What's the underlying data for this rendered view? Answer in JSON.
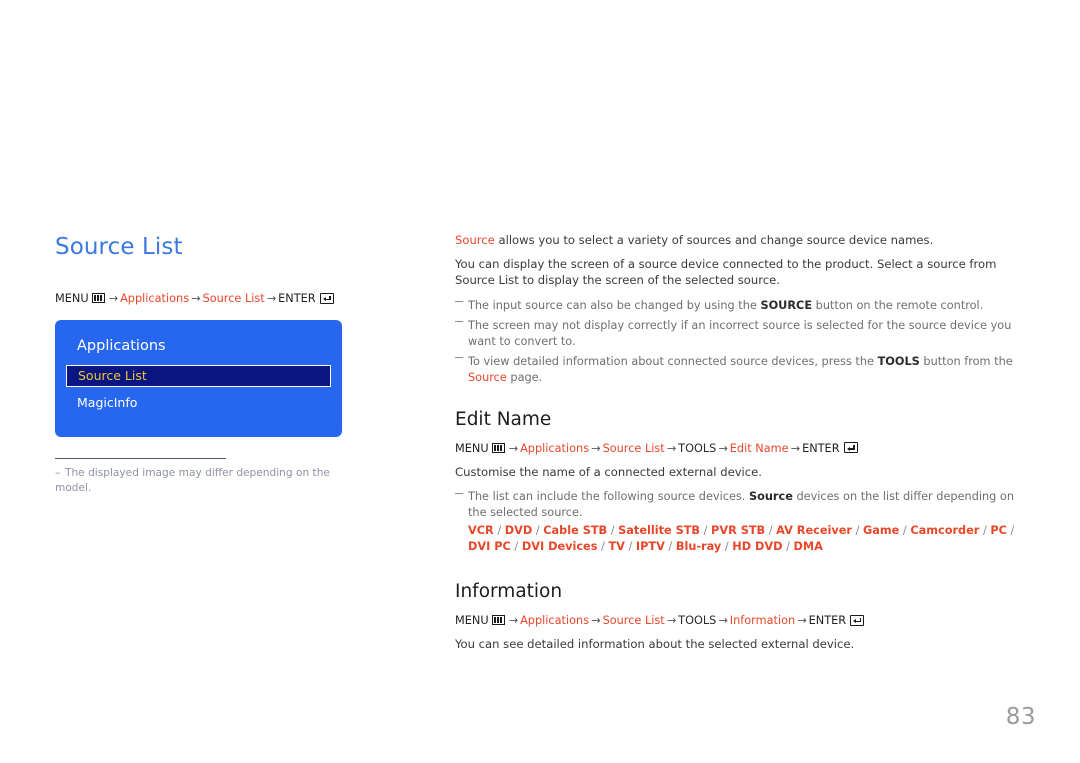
{
  "page": {
    "number": "83"
  },
  "left": {
    "title": "Source List",
    "menu_path": {
      "menu_label": "MENU",
      "menu_icon": "menu-grid-icon",
      "steps": [
        "Applications",
        "Source List"
      ],
      "enter_label": "ENTER",
      "enter_icon": "enter-return-icon",
      "arrow": "→"
    },
    "osd": {
      "title": "Applications",
      "items": [
        {
          "label": "Source List",
          "selected": true
        },
        {
          "label": "MagicInfo",
          "selected": false
        }
      ]
    },
    "note": {
      "dash": "–",
      "text": "The displayed image may differ depending on the model."
    }
  },
  "right": {
    "intro": {
      "highlight": "Source",
      "rest": " allows you to select a variety of sources and change source device names."
    },
    "description": "You can display the screen of a source device connected to the product. Select a source from Source List to display the screen of the selected source.",
    "bullets": [
      {
        "pre": "The input source can also be changed by using the ",
        "strong": "SOURCE",
        "post": " button on the remote control."
      },
      {
        "pre": "The screen may not display correctly if an incorrect source is selected for the source device you want to convert to.",
        "strong": "",
        "post": ""
      },
      {
        "pre": "To view detailed information about connected source devices, press the ",
        "strong": "TOOLS",
        "mid": " button from the ",
        "highlight": "Source",
        "post": " page."
      }
    ],
    "edit_name": {
      "heading": "Edit Name",
      "menu_path": {
        "menu_label": "MENU",
        "steps": [
          "Applications",
          "Source List",
          "TOOLS",
          "Edit Name"
        ],
        "plain_steps": [
          "TOOLS"
        ],
        "enter_label": "ENTER"
      },
      "description": "Customise the name of a connected external device.",
      "bullet": {
        "pre": "The list can include the following source devices. ",
        "highlight": "Source",
        "post": " devices on the list differ depending on the selected source."
      },
      "devices": [
        "VCR",
        "DVD",
        "Cable STB",
        "Satellite STB",
        "PVR STB",
        "AV Receiver",
        "Game",
        "Camcorder",
        "PC",
        "DVI PC",
        "DVI Devices",
        "TV",
        "IPTV",
        "Blu-ray",
        "HD DVD",
        "DMA"
      ],
      "device_separator": " / "
    },
    "information": {
      "heading": "Information",
      "menu_path": {
        "menu_label": "MENU",
        "steps": [
          "Applications",
          "Source List",
          "TOOLS",
          "Information"
        ],
        "enter_label": "ENTER"
      },
      "description": "You can see detailed information about the selected external device."
    }
  },
  "colors": {
    "title_blue": "#3b79e0",
    "accent_orange": "#e8472a",
    "osd_blue": "#2767f0",
    "osd_selected_bg": "#0b1582",
    "osd_selected_text": "#e8c832",
    "page_number_gray": "#9a9a9a"
  }
}
